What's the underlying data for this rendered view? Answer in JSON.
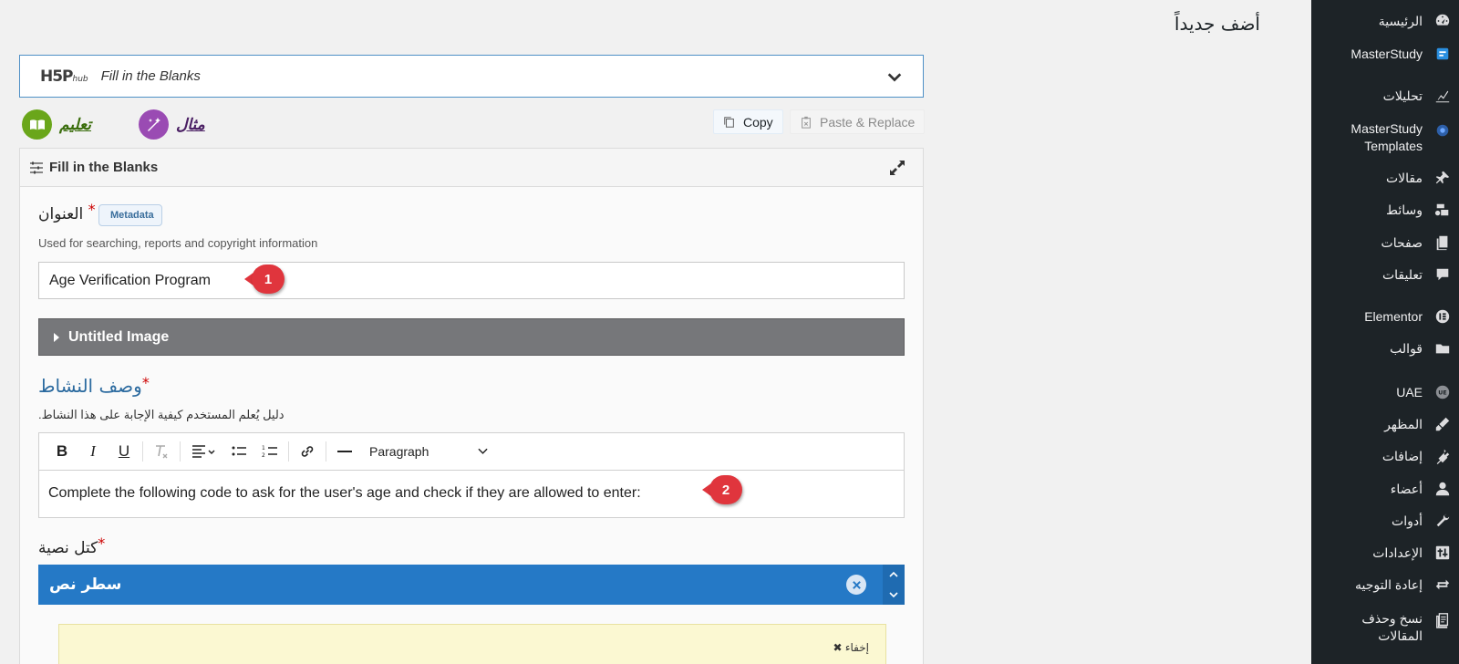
{
  "page": {
    "title": "أضف جديداً"
  },
  "sidebar": {
    "items": [
      {
        "label": "الرئيسية",
        "icon": "dashboard-icon"
      },
      {
        "label": "MasterStudy",
        "icon": "masterstudy-icon"
      },
      {
        "label": "تحليلات",
        "icon": "analytics-icon"
      },
      {
        "label": "MasterStudy Templates",
        "icon": "templates-icon"
      },
      {
        "label": "مقالات",
        "icon": "pin-icon"
      },
      {
        "label": "وسائط",
        "icon": "media-icon"
      },
      {
        "label": "صفحات",
        "icon": "pages-icon"
      },
      {
        "label": "تعليقات",
        "icon": "comments-icon"
      },
      {
        "label": "Elementor",
        "icon": "elementor-icon"
      },
      {
        "label": "قوالب",
        "icon": "folder-icon"
      },
      {
        "label": "UAE",
        "icon": "uae-icon"
      },
      {
        "label": "المظهر",
        "icon": "appearance-icon"
      },
      {
        "label": "إضافات",
        "icon": "plugins-icon"
      },
      {
        "label": "أعضاء",
        "icon": "users-icon"
      },
      {
        "label": "أدوات",
        "icon": "tools-icon"
      },
      {
        "label": "الإعدادات",
        "icon": "settings-icon"
      },
      {
        "label": "إعادة التوجيه",
        "icon": "redirect-icon"
      },
      {
        "label": "نسخ وحذف المقالات",
        "icon": "copy-delete-icon"
      }
    ]
  },
  "hub": {
    "logo": "H5P",
    "logo_sub": "hub",
    "content_type": "Fill in the Blanks"
  },
  "links": {
    "tutorial": "تعليم",
    "example": "مثال"
  },
  "actions": {
    "copy": "Copy",
    "paste": "Paste & Replace"
  },
  "panel": {
    "title": "Fill in the Blanks",
    "title_field": {
      "label": "العنوان",
      "required": "*",
      "metadata": "Metadata",
      "description": "Used for searching, reports and copyright information",
      "value": "Age Verification Program"
    },
    "image_group": {
      "label": "Untitled Image"
    },
    "task": {
      "label": "وصف النشاط",
      "required": "*",
      "description": "دليل يُعلم المستخدم كيفية الإجابة على هذا النشاط.",
      "paragraph_format": "Paragraph",
      "content": "Complete the following code to ask for the user's age and check if they are allowed to enter:"
    },
    "blocks": {
      "label": "كتل نصية",
      "required": "*",
      "item": "سطر نص",
      "hide": "إخفاء"
    }
  },
  "callouts": {
    "first": "1",
    "second": "2"
  },
  "colors": {
    "sidebar": "#1d2327",
    "accent": "#2579c6",
    "callout": "#e0353d",
    "image_bar": "#76777a"
  }
}
